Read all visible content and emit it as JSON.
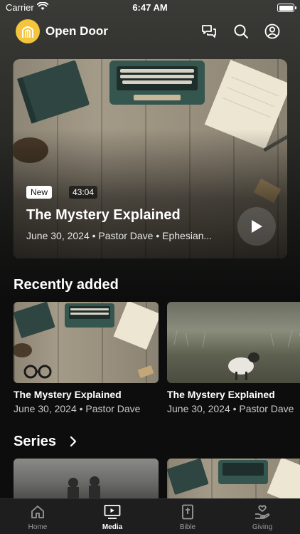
{
  "status_bar": {
    "carrier": "Carrier",
    "time": "6:47 AM"
  },
  "header": {
    "title": "Open Door"
  },
  "hero": {
    "badge": "New",
    "duration": "43:04",
    "title": "The Mystery Explained",
    "meta": "June 30, 2024 • Pastor Dave • Ephesian..."
  },
  "recently_added": {
    "title": "Recently added",
    "items": [
      {
        "title": "The Mystery Explained",
        "meta": "June 30, 2024 • Pastor Dave"
      },
      {
        "title": "The Mystery Explained",
        "meta": "June 30, 2024 • Pastor Dave"
      }
    ]
  },
  "series": {
    "title": "Series"
  },
  "tabs": [
    {
      "label": "Home",
      "icon": "home-icon"
    },
    {
      "label": "Media",
      "icon": "media-icon",
      "active": true
    },
    {
      "label": "Bible",
      "icon": "bible-icon"
    },
    {
      "label": "Giving",
      "icon": "giving-icon"
    }
  ],
  "colors": {
    "brand": "#f2c53d",
    "background": "#0d0d0d",
    "tab_bar": "#1e1e1e"
  }
}
